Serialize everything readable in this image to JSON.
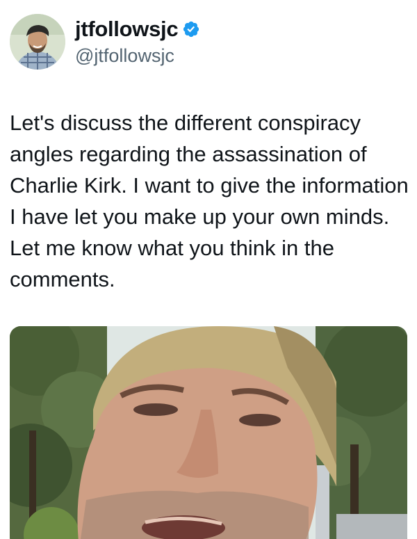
{
  "author": {
    "display_name": "jtfollowsjc",
    "handle": "@jtfollowsjc",
    "verified": true,
    "verified_color": "#1d9bf0",
    "avatar_icon": "profile-photo"
  },
  "tweet": {
    "text": "Let's discuss the different conspiracy angles regarding the assassination of Charlie Kirk. I want to give the information I have let you make up your own minds. Let me know what you think in the comments."
  },
  "media": {
    "type": "video-thumbnail",
    "icon": "video-still"
  },
  "colors": {
    "text": "#0f1419",
    "secondary": "#536471",
    "background": "#ffffff"
  }
}
